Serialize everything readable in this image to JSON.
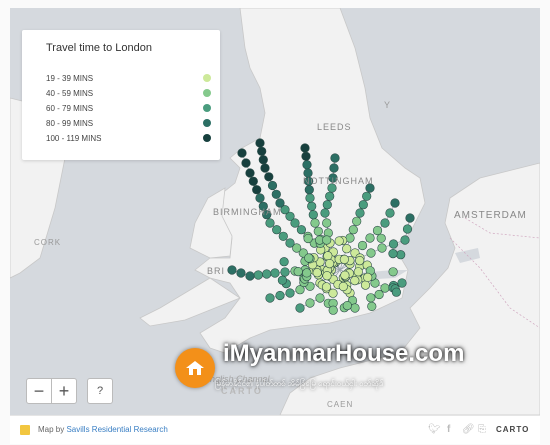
{
  "legend": {
    "title": "Travel time to London",
    "items": [
      {
        "label": "19 - 39 MINS",
        "color": "#cde99a"
      },
      {
        "label": "40 - 59 MINS",
        "color": "#84c98c"
      },
      {
        "label": "60 - 79 MINS",
        "color": "#4a9c7e"
      },
      {
        "label": "80 - 99 MINS",
        "color": "#2c6f64"
      },
      {
        "label": "100 - 119 MINS",
        "color": "#17403e"
      }
    ]
  },
  "map_labels": {
    "leeds": "LEEDS",
    "nottingham": "NOTTINGHAM",
    "birmingham": "BIRMINGHAM",
    "amsterdam": "AMSTERDAM",
    "bristol": "BRI",
    "cork": "CORK",
    "english_channel": "English Channel",
    "caen": "CAEN",
    "carto": "CARTO",
    "y_ork": "Y"
  },
  "controls": {
    "zoom_out": "−",
    "zoom_in": "+",
    "help": "?"
  },
  "footer": {
    "prefix": "Map by",
    "link": "Savills Residential Research",
    "carto": "CARTO"
  },
  "watermark": {
    "title": "iMyanmarHouse.com",
    "subtitle": "မြန်မာနိုင်ငံ၏ နံပါတ်တစ် အိမ်ခြံမြေ ရောင်းဝယ်ငှါး ဝဘ်ဆိုဒ်"
  }
}
